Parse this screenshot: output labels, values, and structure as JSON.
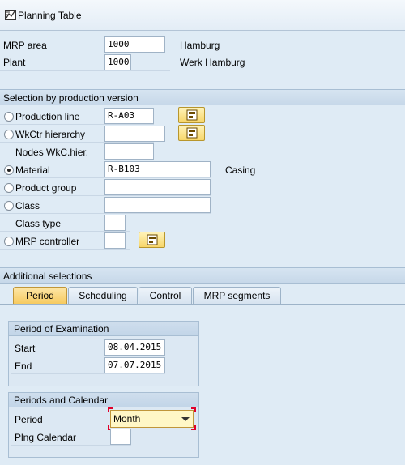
{
  "title": "Planning Table",
  "icons": {
    "title": "planning-table-icon",
    "matchcode": "matchcode-icon",
    "dropdown": "chevron-down-icon"
  },
  "header_fields": [
    {
      "label": "MRP area",
      "value": "1000",
      "desc": "Hamburg"
    },
    {
      "label": "Plant",
      "value": "1000",
      "desc": "Werk Hamburg"
    }
  ],
  "selection": {
    "title": "Selection by production version",
    "production_line": {
      "label": "Production line",
      "value": "R-A03"
    },
    "wkctr_hierarchy": {
      "label": "WkCtr hierarchy",
      "value": ""
    },
    "nodes": {
      "label": "Nodes WkC.hier.",
      "value": ""
    },
    "material": {
      "label": "Material",
      "value": "R-B103",
      "desc": "Casing"
    },
    "product_group": {
      "label": "Product group",
      "value": ""
    },
    "class": {
      "label": "Class",
      "value": ""
    },
    "class_type": {
      "label": "Class type",
      "value": ""
    },
    "mrp_controller": {
      "label": "MRP controller",
      "value": ""
    },
    "selected": "material"
  },
  "additional": {
    "title": "Additional selections",
    "tabs": [
      "Period",
      "Scheduling",
      "Control",
      "MRP segments"
    ],
    "active_tab": "Period",
    "period_examination": {
      "title": "Period of Examination",
      "start_label": "Start",
      "start_value": "08.04.2015",
      "end_label": "End",
      "end_value": "07.07.2015"
    },
    "periods_calendar": {
      "title": "Periods and Calendar",
      "period_label": "Period",
      "period_value": "Month",
      "calendar_label": "Plng Calendar",
      "calendar_value": ""
    }
  },
  "colors": {
    "background": "#dfebf5",
    "active_tab": "#f6c95c",
    "focus": "#e0002a"
  }
}
